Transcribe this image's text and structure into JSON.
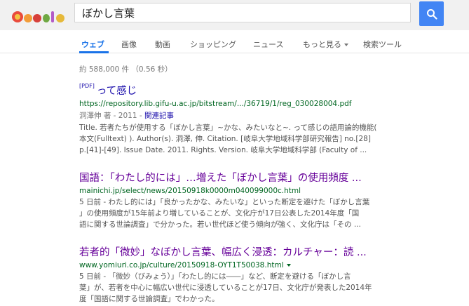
{
  "search": {
    "query": "ぼかし言葉"
  },
  "tabs": [
    {
      "label": "ウェブ"
    },
    {
      "label": "画像"
    },
    {
      "label": "動画"
    },
    {
      "label": "ショッピング"
    },
    {
      "label": "ニュース"
    },
    {
      "label": "もっと見る"
    },
    {
      "label": "検索ツール"
    }
  ],
  "stats": "約 588,000 件 （0.56 秒）",
  "results": [
    {
      "badge": "[PDF]",
      "title": "って感じ",
      "url": "https://repository.lib.gifu-u.ac.jp/bitstream/.../36719/1/reg_030028004.pdf",
      "meta": "洞澤伸 著 - 2011 - ",
      "related": "関連記事",
      "snippet_lines": [
        "Title. 若者たちが使用する「ぼかし言葉」~かな、みたいなと~. って感じの語用論的機能(",
        "本文(Fulltext) ). Author(s). 洞澤, 伸. Citation. [岐阜大学地域科学部研究報告] no.[28]",
        "p.[41]-[49]. Issue Date. 2011. Rights. Version. 岐阜大学地域科学部 (Faculty of ..."
      ]
    },
    {
      "title": "国語：「わたし的には」…増えた「ぼかし言葉」の使用頻度 ...",
      "url": "mainichi.jp/select/news/20150918k0000m040099000c.html",
      "snippet_lines": [
        "5 日前 - わたし的には」「良かったかな、みたいな」といった断定を避けた「ぼかし言葉",
        "」の使用頻度が15年前より増していることが、文化庁が17日公表した2014年度「国",
        "語に関する世論調査」で分かった。若い世代ほど使う傾向が強く、文化庁は「その ..."
      ]
    },
    {
      "title": "若者的「微妙」なぼかし言葉、幅広く浸透：カルチャー：読 ...",
      "url": "www.yomiuri.co.jp/culture/20150918-OYT1T50038.html",
      "snippet_lines": [
        "5 日前 - 「微妙（びみょう）」「わたし的には――」など、断定を避ける「ぼかし言",
        "葉」が、若者を中心に幅広い世代に浸透していることが17日、文化庁が発表した2014年",
        "度「国語に関する世論調査」でわかった。"
      ]
    }
  ]
}
